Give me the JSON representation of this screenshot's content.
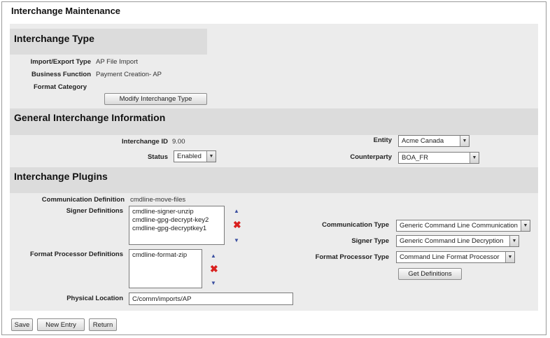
{
  "page": {
    "title": "Interchange Maintenance"
  },
  "interchange_type": {
    "heading": "Interchange Type",
    "import_export_label": "Import/Export Type",
    "import_export_value": "AP File Import",
    "business_function_label": "Business Function",
    "business_function_value": "Payment Creation- AP",
    "format_category_label": "Format Category",
    "format_category_value": "",
    "modify_button": "Modify Interchange Type"
  },
  "general": {
    "heading": "General Interchange Information",
    "interchange_id_label": "Interchange ID",
    "interchange_id_value": "9.00",
    "status_label": "Status",
    "status_value": "Enabled",
    "entity_label": "Entity",
    "entity_value": "Acme Canada",
    "counterparty_label": "Counterparty",
    "counterparty_value": "BOA_FR"
  },
  "plugins": {
    "heading": "Interchange Plugins",
    "communication_definition_label": "Communication Definition",
    "communication_definition_value": "cmdline-move-files",
    "signer_definitions_label": "Signer Definitions",
    "signer_definitions": [
      "cmdline-signer-unzip",
      "cmdline-gpg-decrypt-key2",
      "cmdline-gpg-decryptkey1"
    ],
    "format_processor_label": "Format Processor Definitions",
    "format_processor_definitions": [
      "cmdline-format-zip"
    ],
    "physical_location_label": "Physical Location",
    "physical_location_value": "C/comm/imports/AP",
    "communication_type_label": "Communication Type",
    "communication_type_value": "Generic Command Line Communication",
    "signer_type_label": "Signer Type",
    "signer_type_value": "Generic Command Line Decryption",
    "format_processor_type_label": "Format Processor Type",
    "format_processor_type_value": "Command Line Format Processor",
    "get_definitions_button": "Get Definitions"
  },
  "footer": {
    "save": "Save",
    "new_entry": "New Entry",
    "return": "Return"
  },
  "icons": {
    "move_up": "triangle-up-icon",
    "move_down": "triangle-down-icon",
    "remove": "red-x-icon",
    "dropdown": "chevron-down-icon"
  },
  "colors": {
    "panel_bg": "#ececec",
    "section_band": "#dcdcdc",
    "remove_icon": "#d9201e",
    "arrow_icon": "#3a4fa0"
  }
}
